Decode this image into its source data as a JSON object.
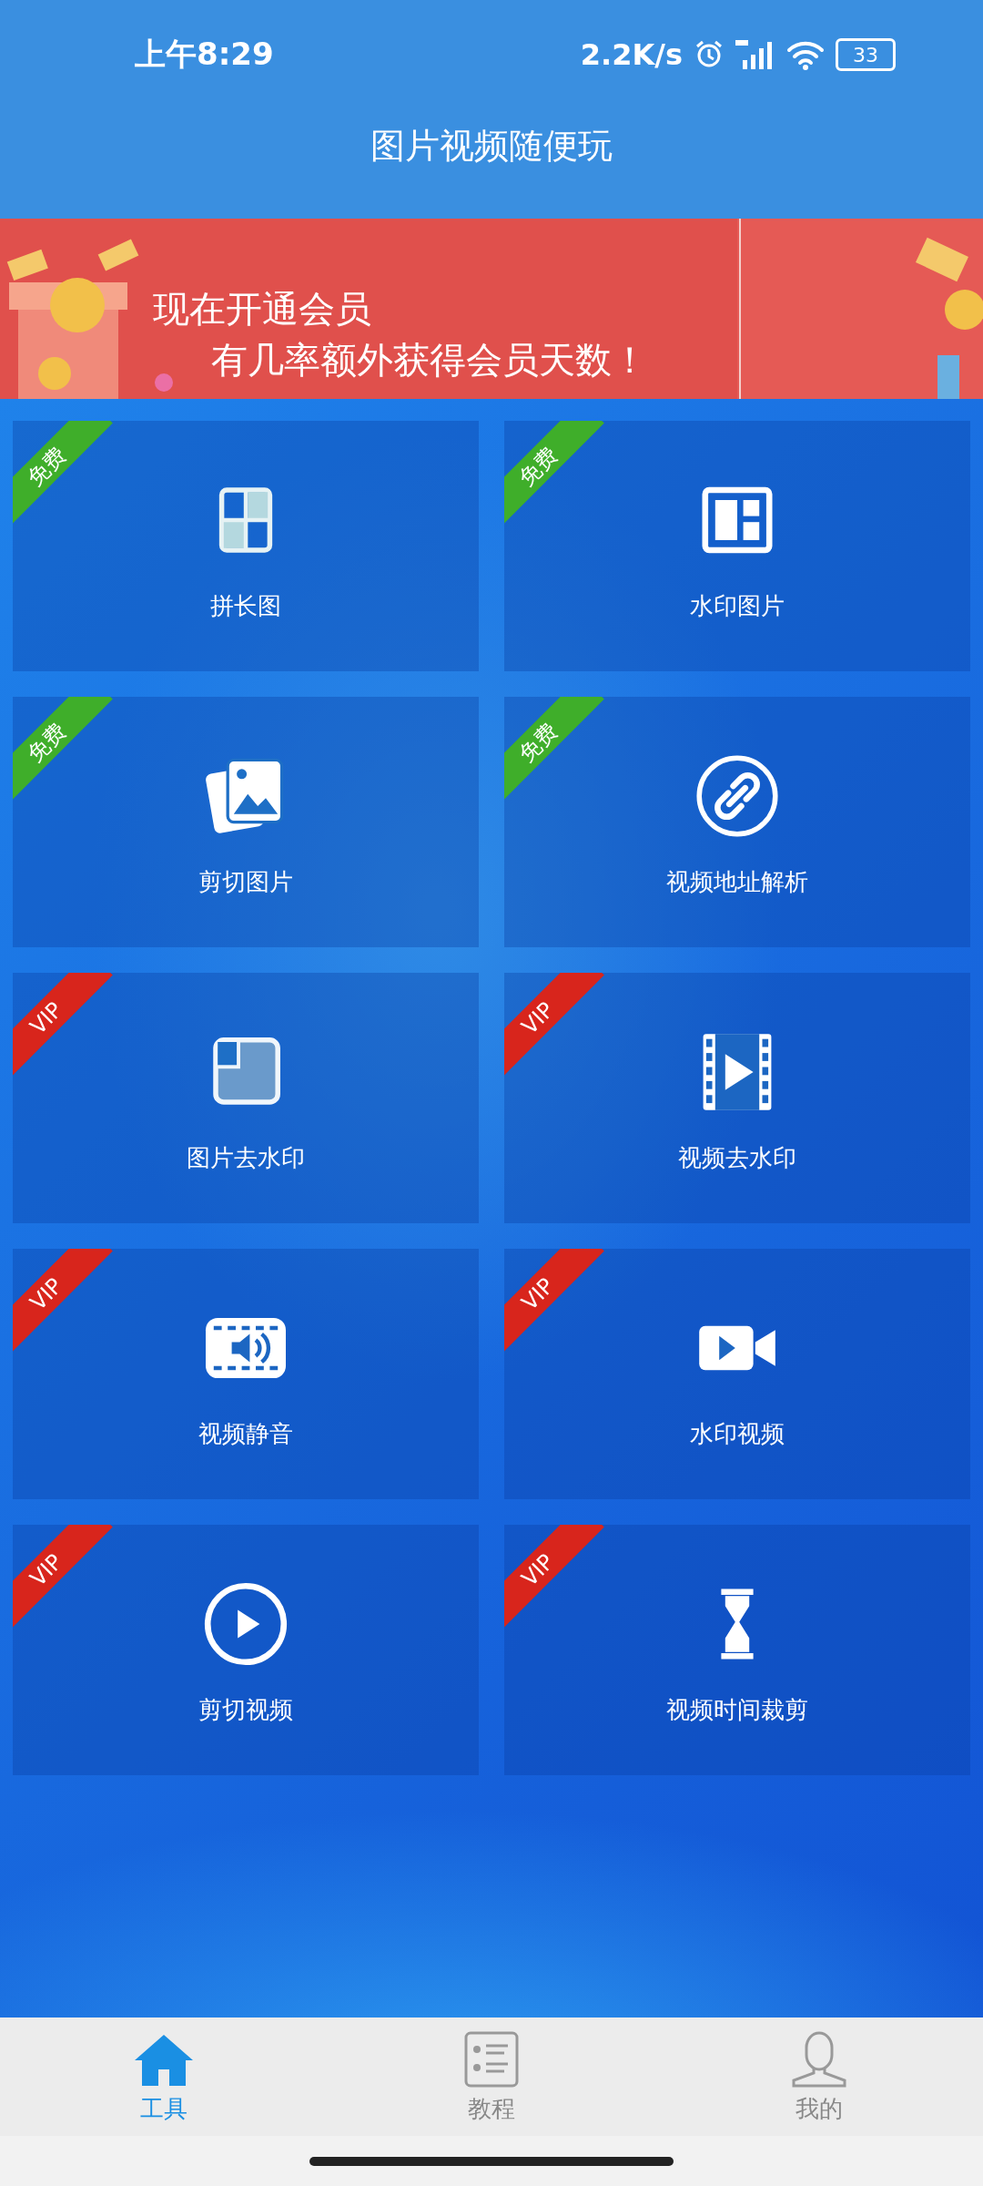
{
  "status_bar": {
    "time": "上午8:29",
    "net_speed": "2.2K/s",
    "battery": "33"
  },
  "title": "图片视频随便玩",
  "banner": {
    "line_1": "现在开通会员",
    "line_2": "有几率额外获得会员天数！"
  },
  "tools": [
    {
      "label": "拼长图",
      "badge": {
        "kind": "free",
        "text": "免费"
      }
    },
    {
      "label": "水印图片",
      "badge": {
        "kind": "free",
        "text": "免费"
      }
    },
    {
      "label": "剪切图片",
      "badge": {
        "kind": "free",
        "text": "免费"
      }
    },
    {
      "label": "视频地址解析",
      "badge": {
        "kind": "free",
        "text": "免费"
      }
    },
    {
      "label": "图片去水印",
      "badge": {
        "kind": "vip",
        "text": "VIP"
      }
    },
    {
      "label": "视频去水印",
      "badge": {
        "kind": "vip",
        "text": "VIP"
      }
    },
    {
      "label": "视频静音",
      "badge": {
        "kind": "vip",
        "text": "VIP"
      }
    },
    {
      "label": "水印视频",
      "badge": {
        "kind": "vip",
        "text": "VIP"
      }
    },
    {
      "label": "剪切视频",
      "badge": {
        "kind": "vip",
        "text": "VIP"
      }
    },
    {
      "label": "视频时间裁剪",
      "badge": {
        "kind": "vip",
        "text": "VIP"
      }
    }
  ],
  "tab_bar": [
    {
      "label": "工具",
      "selected": true
    },
    {
      "label": "教程",
      "selected": false
    },
    {
      "label": "我的",
      "selected": false
    }
  ]
}
